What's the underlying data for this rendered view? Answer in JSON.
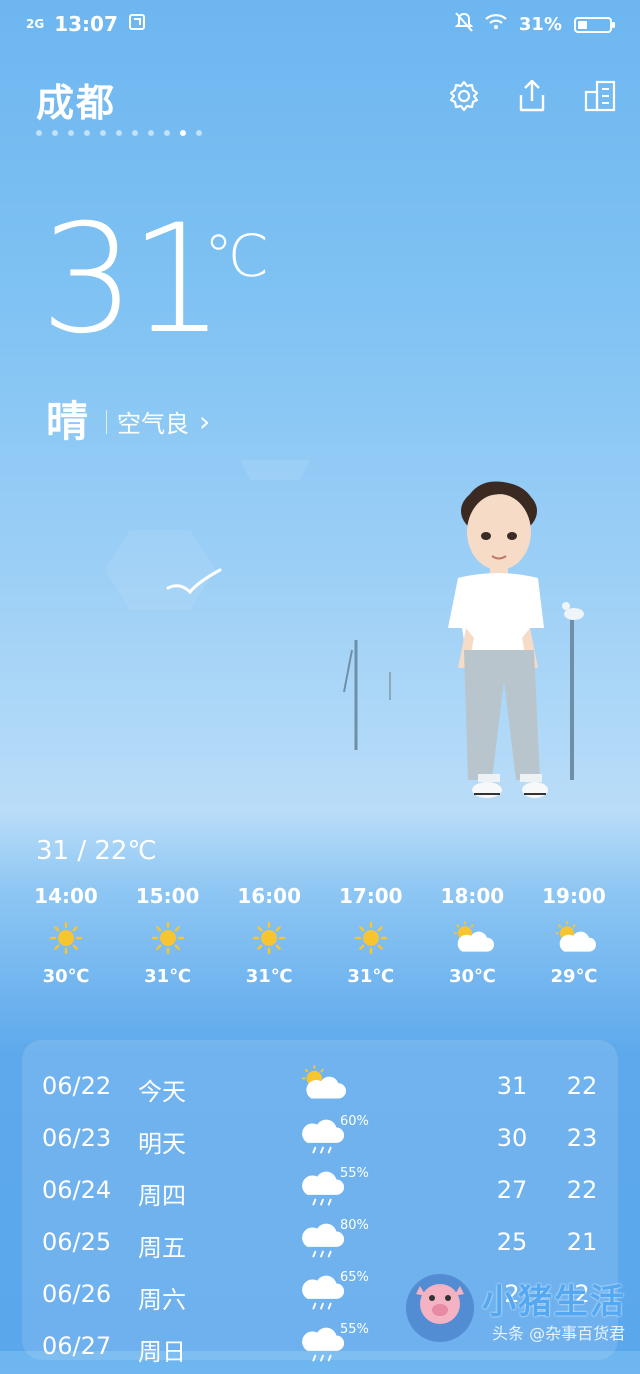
{
  "status_bar": {
    "network": "2G",
    "time": "13:07",
    "battery": "31%",
    "battery_level": 0.31
  },
  "header": {
    "city": "成都",
    "page_count": 11,
    "active_page_index": 9,
    "icons": [
      "gear-icon",
      "share-icon",
      "city-list-icon"
    ]
  },
  "current": {
    "temperature": "31",
    "unit": "℃",
    "condition": "晴",
    "air_quality": "空气良",
    "air_arrow": "›"
  },
  "today_range": "31 / 22℃",
  "hourly": [
    {
      "time": "14:00",
      "icon": "sun-icon",
      "temp": "30℃"
    },
    {
      "time": "15:00",
      "icon": "sun-icon",
      "temp": "31℃"
    },
    {
      "time": "16:00",
      "icon": "sun-icon",
      "temp": "31℃"
    },
    {
      "time": "17:00",
      "icon": "sun-icon",
      "temp": "31℃"
    },
    {
      "time": "18:00",
      "icon": "partly-cloudy-icon",
      "temp": "30℃"
    },
    {
      "time": "19:00",
      "icon": "partly-cloudy-icon",
      "temp": "29℃"
    }
  ],
  "daily": [
    {
      "date": "06/22",
      "day": "今天",
      "icon": "partly-cloudy-icon",
      "pop": "",
      "hi": "31",
      "lo": "22"
    },
    {
      "date": "06/23",
      "day": "明天",
      "icon": "rain-icon",
      "pop": "60%",
      "hi": "30",
      "lo": "23"
    },
    {
      "date": "06/24",
      "day": "周四",
      "icon": "rain-icon",
      "pop": "55%",
      "hi": "27",
      "lo": "22"
    },
    {
      "date": "06/25",
      "day": "周五",
      "icon": "rain-icon",
      "pop": "80%",
      "hi": "25",
      "lo": "21"
    },
    {
      "date": "06/26",
      "day": "周六",
      "icon": "rain-icon",
      "pop": "65%",
      "hi": "2",
      "lo": "2"
    },
    {
      "date": "06/27",
      "day": "周日",
      "icon": "rain-icon",
      "pop": "55%",
      "hi": "",
      "lo": ""
    }
  ],
  "watermark": {
    "title": "小猪生活",
    "credit": "头条 @杂事百货君"
  },
  "colors": {
    "sun": "#f7c531",
    "cloud": "#ffffff",
    "accent": "#54a8f2"
  }
}
